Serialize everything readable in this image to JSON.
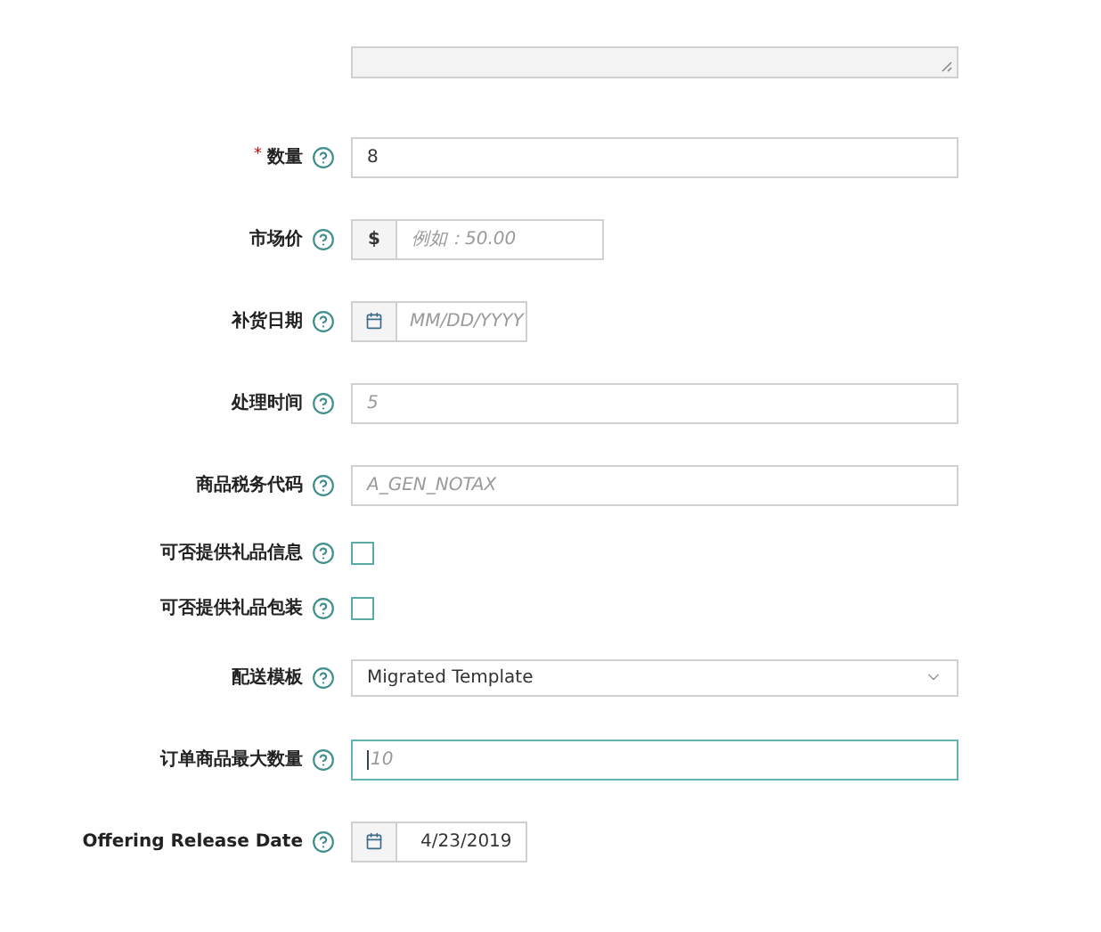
{
  "fields": [
    {
      "kind": "text",
      "label": "数量",
      "required_mark": "*",
      "value": "8",
      "focused": false
    },
    {
      "kind": "currency",
      "label": "市场价",
      "prefix": "$",
      "placeholder": "例如：50.00"
    },
    {
      "kind": "date",
      "label": "补货日期",
      "placeholder": "MM/DD/YYYY"
    },
    {
      "kind": "text",
      "label": "处理时间",
      "placeholder": "5",
      "focused": false
    },
    {
      "kind": "text",
      "label": "商品税务代码",
      "placeholder": "A_GEN_NOTAX",
      "focused": false
    },
    {
      "kind": "checkbox",
      "label": "可否提供礼品信息",
      "checked": false
    },
    {
      "kind": "checkbox",
      "label": "可否提供礼品包装",
      "checked": false
    },
    {
      "kind": "select",
      "label": "配送模板",
      "value": "Migrated Template"
    },
    {
      "kind": "text",
      "label": "订单商品最大数量",
      "placeholder": "10",
      "focused": true
    },
    {
      "kind": "date",
      "label": "Offering Release Date",
      "value": "4/23/2019"
    }
  ]
}
